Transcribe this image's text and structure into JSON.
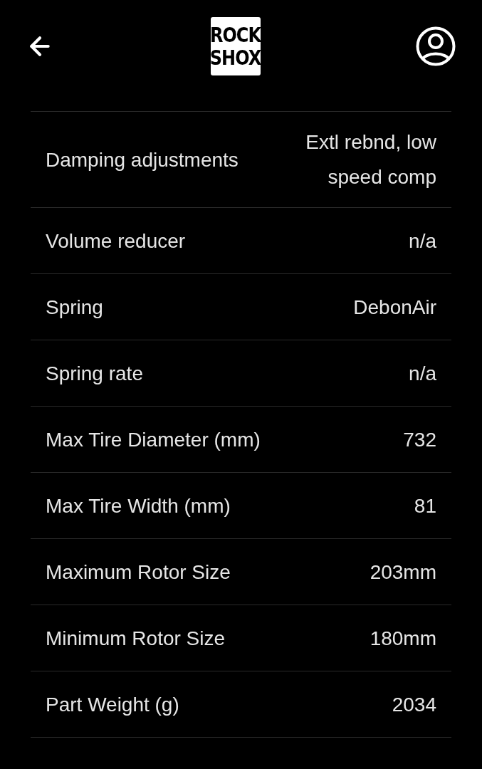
{
  "header": {
    "logo_lines": [
      "ROCK",
      "SHOX"
    ]
  },
  "specs": [
    {
      "label": "Damping adjustments",
      "value": "Extl rebnd, low speed comp"
    },
    {
      "label": "Volume reducer",
      "value": "n/a"
    },
    {
      "label": "Spring",
      "value": "DebonAir"
    },
    {
      "label": "Spring rate",
      "value": "n/a"
    },
    {
      "label": "Max Tire Diameter (mm)",
      "value": "732"
    },
    {
      "label": "Max Tire Width (mm)",
      "value": "81"
    },
    {
      "label": "Maximum Rotor Size",
      "value": "203mm"
    },
    {
      "label": "Minimum Rotor Size",
      "value": "180mm"
    },
    {
      "label": "Part Weight (g)",
      "value": "2034"
    }
  ]
}
